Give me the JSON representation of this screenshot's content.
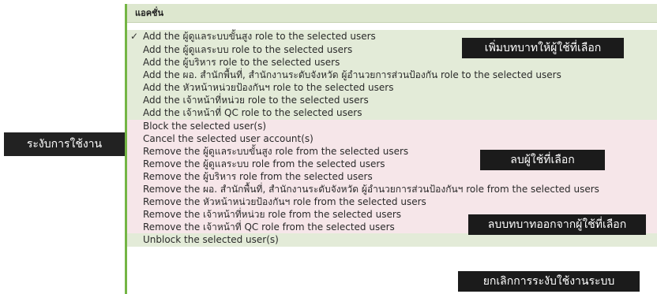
{
  "side_label": "ระงับการใช้งาน",
  "header": {
    "title": "แอคชั่น"
  },
  "check_glyph": "✓",
  "options": [
    {
      "label": "Add the ผู้ดูแลระบบขั้นสูง role to the selected users",
      "group": "green",
      "selected": true
    },
    {
      "label": "Add the ผู้ดูแลระบบ role to the selected users",
      "group": "green"
    },
    {
      "label": "Add the ผู้บริหาร role to the selected users",
      "group": "green"
    },
    {
      "label": "Add the ผอ. สำนักพื้นที่, สำนักงานระดับจังหวัด ผู้อำนวยการส่วนป้องกัน role to the selected users",
      "group": "green"
    },
    {
      "label": "Add the หัวหน้าหน่วยป้องกันฯ role to the selected users",
      "group": "green"
    },
    {
      "label": "Add the เจ้าหน้าที่หน่วย role to the selected users",
      "group": "green"
    },
    {
      "label": "Add the เจ้าหน้าที่ QC role to the selected users",
      "group": "green"
    },
    {
      "label": "Block the selected user(s)",
      "group": "pink"
    },
    {
      "label": "Cancel the selected user account(s)",
      "group": "pink"
    },
    {
      "label": "Remove the ผู้ดูแลระบบขั้นสูง role from the selected users",
      "group": "pink"
    },
    {
      "label": "Remove the ผู้ดูแลระบบ role from the selected users",
      "group": "pink"
    },
    {
      "label": "Remove the ผู้บริหาร role from the selected users",
      "group": "pink"
    },
    {
      "label": "Remove the ผอ. สำนักพื้นที่, สำนักงานระดับจังหวัด ผู้อำนวยการส่วนป้องกันฯ role from the selected users",
      "group": "pink"
    },
    {
      "label": "Remove the หัวหน้าหน่วยป้องกันฯ role from the selected users",
      "group": "pink"
    },
    {
      "label": "Remove the เจ้าหน้าที่หน่วย role from the selected users",
      "group": "pink"
    },
    {
      "label": "Remove the เจ้าหน้าที่ QC role from the selected users",
      "group": "pink"
    },
    {
      "label": "Unblock the selected user(s)",
      "group": "green"
    }
  ],
  "callouts": {
    "add_roles": "เพิ่มบทบาทให้ผู้ใช้ที่เลือก",
    "delete_user": "ลบผู้ใช้ที่เลือก",
    "remove_roles": "ลบบทบาทออกจากผู้ใช้ที่เลือก",
    "unblock": "ยกเลิกการระงับใช้งานระบบ"
  },
  "colors": {
    "accent": "#74b545",
    "green_row": "#e3ebd8",
    "pink_row": "#f6e6e9",
    "callout_bg": "#1b1b1b"
  }
}
